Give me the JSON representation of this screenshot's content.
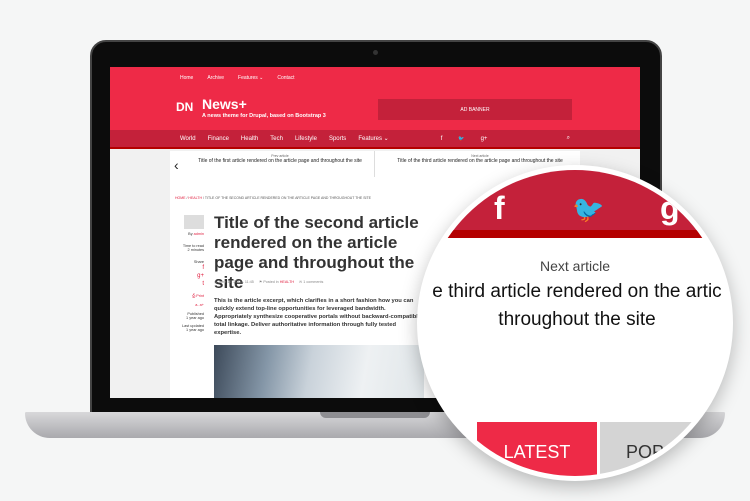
{
  "top_menu": [
    "Home",
    "Archive",
    "Features ⌄",
    "Contact"
  ],
  "site": {
    "name": "News+",
    "tagline": "A news theme for Drupal, based on Bootstrap 3",
    "logo_text": "DN"
  },
  "ad_banner": "AD BANNER",
  "main_menu": [
    "World",
    "Finance",
    "Health",
    "Tech",
    "Lifestyle",
    "Sports",
    "Features ⌄"
  ],
  "social": {
    "facebook": "f",
    "twitter": "🐦",
    "google_plus": "g+"
  },
  "search_icon": "⌕",
  "pager": {
    "prev_label": "Prev article",
    "prev_title": "Title of the first article rendered on the article page and throughout the site",
    "next_label": "Next article",
    "next_title": "Title of the third article rendered on the article page and throughout the site"
  },
  "breadcrumb": {
    "home": "HOME",
    "section": "HEALTH",
    "current": "TITLE OF THE SECOND ARTICLE RENDERED ON THE ARTICLE PAGE AND THROUGHOUT THE SITE"
  },
  "article": {
    "title": "Title of the second article rendered on the article page and throughout the site",
    "date": "June 17, 2014 - 11:45",
    "posted_in_label": "Posted in",
    "category": "HEALTH",
    "comments": "1 comments",
    "excerpt": "This is the article excerpt, which clarifies in a short fashion how you can quickly extend top-line opportunities for leveraged bandwidth. Appropriately synthesize cooperative portals without backward-compatible total linkage. Deliver authoritative information through fully tested expertise."
  },
  "sidebar": {
    "by_label": "By",
    "author": "admin",
    "time_label": "Time to read",
    "time_value": "2 minutes",
    "share_label": "Share",
    "print": "Print",
    "font_size": "a- a+",
    "published_label": "Published",
    "published_value": "1 year ago",
    "updated_label": "Last updated",
    "updated_value": "1 year ago"
  },
  "tabs": {
    "latest": "LATEST",
    "popular": "POP"
  },
  "magnifier": {
    "next_label": "Next article",
    "line1": "e third article rendered on the artic",
    "line2": "throughout the site"
  },
  "colors": {
    "primary": "#ee2a47",
    "nav": "#c4213a",
    "accent_line": "#b40000"
  }
}
